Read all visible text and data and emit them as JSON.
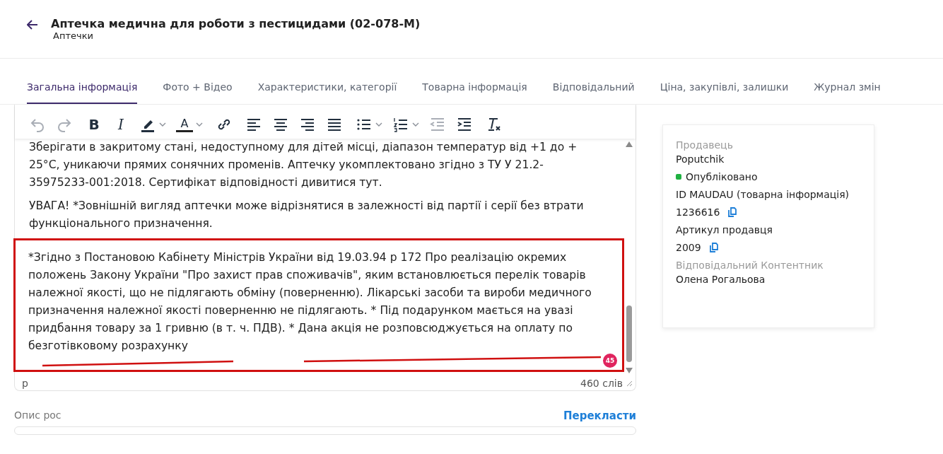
{
  "header": {
    "title": "Аптечка медична для роботи з пестицидами (02-078-М)",
    "subtitle": "Аптечки"
  },
  "tabs": [
    {
      "label": "Загальна інформація",
      "selected": true
    },
    {
      "label": "Фото + Відео",
      "selected": false
    },
    {
      "label": "Характеристики, категорії",
      "selected": false
    },
    {
      "label": "Товарна інформація",
      "selected": false
    },
    {
      "label": "Відповідальний",
      "selected": false
    },
    {
      "label": "Ціна, закупівлі, залишки",
      "selected": false
    },
    {
      "label": "Журнал змін",
      "selected": false
    }
  ],
  "editor": {
    "toolbar": [
      [
        {
          "kind": "undo",
          "disabled": true
        },
        {
          "kind": "redo",
          "disabled": true
        }
      ],
      [
        {
          "kind": "bold",
          "label": "B",
          "disabled": false
        },
        {
          "kind": "italic",
          "label": "I",
          "disabled": false
        },
        {
          "kind": "highlight",
          "disabled": false
        },
        {
          "kind": "textcolor",
          "label": "A",
          "disabled": false
        }
      ],
      [
        {
          "kind": "link",
          "disabled": false
        }
      ],
      [
        {
          "kind": "align-left",
          "disabled": false
        },
        {
          "kind": "align-center",
          "disabled": false
        },
        {
          "kind": "align-right",
          "disabled": false
        },
        {
          "kind": "align-justify",
          "disabled": false
        }
      ],
      [
        {
          "kind": "bullet-list",
          "disabled": false
        },
        {
          "kind": "number-list",
          "disabled": false
        },
        {
          "kind": "outdent",
          "disabled": true
        },
        {
          "kind": "indent",
          "disabled": false
        }
      ],
      [
        {
          "kind": "clear-format",
          "disabled": false
        }
      ]
    ],
    "paragraphs": [
      {
        "text": "Зберігати в закритому стані, недоступному для дітей місці, діапазон температур від +1 до + 25°С, уникаючи прямих сонячних променів. Аптечку укомплектовано згідно з ТУ У 21.2-35975233-001:2018. Сертифікат відповідності дивитися тут.",
        "highlighted": false
      },
      {
        "text": "УВАГА!  *Зовнішній вигляд аптечки може відрізнятися в залежності від партії і серії без втрати функціонального призначення.",
        "highlighted": false
      },
      {
        "text": "*Згідно з Постановою Кабінету Міністрів України від 19.03.94 р 172 Про реалізацію окремих положень Закону України \"Про захист прав споживачів\", яким встановлюється перелік товарів належної якості, що не підлягають обміну (поверненню). Лікарські засоби та вироби медичного призначення належної якості поверненню не підлягають. * Під подарунком мається на увазі придбання товару за 1 гривню (в т. ч. ПДВ). * Дана акція не розповсюджується на оплату по безготівковому розрахунку",
        "highlighted": true
      }
    ],
    "badge": "45",
    "path": "p",
    "word_count": "460 слів"
  },
  "description": {
    "label": "Опис рос",
    "translate_link": "Перекласти"
  },
  "info_card": {
    "seller_label": "Продавець",
    "seller": "Poputchik",
    "status": {
      "label": "Опубліковано",
      "color": "#1fb141"
    },
    "id_label": "ID MAUDAU (товарна інформація)",
    "id": "1236616",
    "sku_label": "Артикул продавця",
    "sku": "2009",
    "manager_label": "Відповідальний Контентник",
    "manager": "Олена Рогальова"
  }
}
